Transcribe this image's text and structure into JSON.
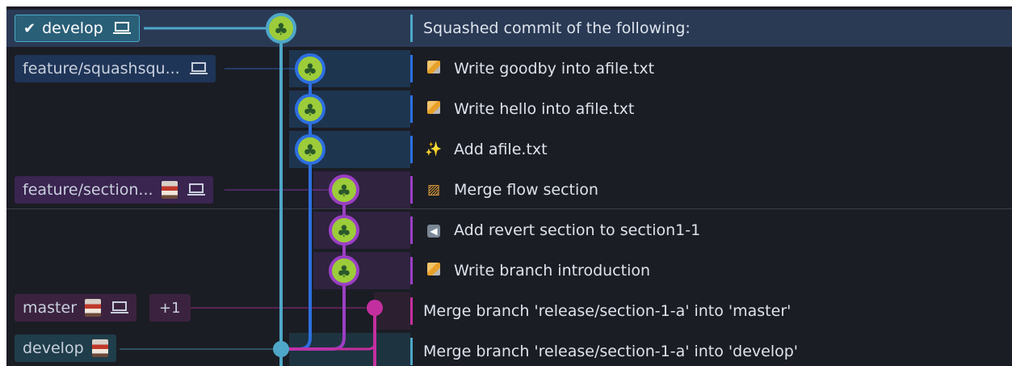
{
  "colors": {
    "teal": "#4ea7c8",
    "blue": "#2d6fe0",
    "purple": "#9b3fc4",
    "magenta": "#c42fa0",
    "node_fill": "#9ccc3a",
    "bg": "#1b1d24"
  },
  "refs": [
    {
      "label": "develop",
      "check": true,
      "laptop": true,
      "avatar": false,
      "style": "head"
    },
    {
      "label": "feature/squashsqu...",
      "check": false,
      "laptop": true,
      "avatar": false,
      "style": "blue"
    },
    {
      "label": "feature/section...",
      "check": false,
      "laptop": true,
      "avatar": true,
      "style": "purple"
    },
    {
      "label": "master",
      "check": false,
      "laptop": true,
      "avatar": true,
      "style": "magenta",
      "extra": "+1"
    },
    {
      "label": "develop",
      "check": false,
      "laptop": false,
      "avatar": true,
      "style": "teal"
    }
  ],
  "commits": [
    {
      "message": "Squashed commit of the following:",
      "emoji": "",
      "branch": "teal",
      "selected": true
    },
    {
      "message": "Write goodby into afile.txt",
      "emoji": "pencil-icon",
      "branch": "blue"
    },
    {
      "message": "Write hello into afile.txt",
      "emoji": "pencil-icon",
      "branch": "blue"
    },
    {
      "message": "Add afile.txt",
      "emoji": "sparkles-icon",
      "branch": "blue"
    },
    {
      "message": "Merge flow section",
      "emoji": "construction-icon",
      "branch": "purple"
    },
    {
      "message": "Add revert section to section1-1",
      "emoji": "rewind-icon",
      "branch": "purple"
    },
    {
      "message": "Write branch introduction",
      "emoji": "pencil-icon",
      "branch": "purple"
    },
    {
      "message": "Merge branch 'release/section-1-a' into 'master'",
      "emoji": "",
      "branch": "magenta"
    },
    {
      "message": "Merge branch 'release/section-1-a' into 'develop'",
      "emoji": "",
      "branch": "teal"
    }
  ]
}
